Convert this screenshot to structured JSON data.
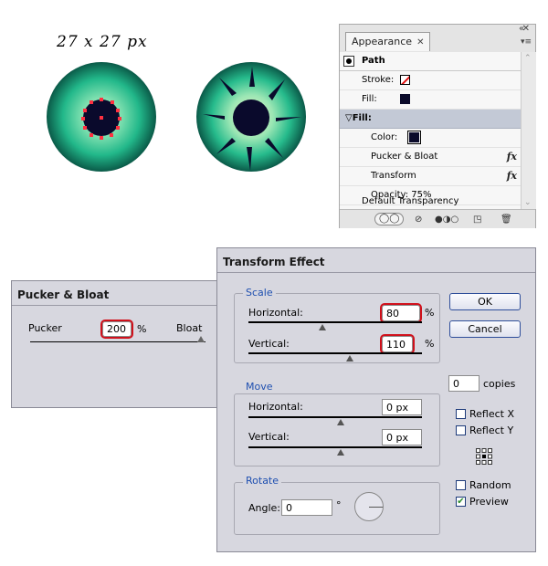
{
  "size_label": "27 x 27 px",
  "appearance": {
    "tab": "Appearance",
    "path_label": "Path",
    "stroke_label": "Stroke:",
    "fill_label": "Fill:",
    "fill_group": "Fill:",
    "color_label": "Color:",
    "pucker_bloat": "Pucker & Bloat",
    "transform": "Transform",
    "opacity": "Opacity: 75%",
    "default_transparency": "Default Transparency",
    "fx_label": "fx",
    "close_glyph": "✕",
    "collapse_glyph": "«",
    "tab_close": "✕",
    "menu_glyph": "▾≡",
    "fill_color": "#0a0a2a"
  },
  "pucker_dialog": {
    "title": "Pucker & Bloat",
    "left_label": "Pucker",
    "value": "200",
    "unit": "%",
    "right_label": "Bloat"
  },
  "transform_dialog": {
    "title": "Transform Effect",
    "scale": {
      "label": "Scale",
      "horizontal_label": "Horizontal:",
      "horizontal_value": "80",
      "vertical_label": "Vertical:",
      "vertical_value": "110",
      "unit": "%"
    },
    "move": {
      "label": "Move",
      "horizontal_label": "Horizontal:",
      "horizontal_value": "0 px",
      "vertical_label": "Vertical:",
      "vertical_value": "0 px"
    },
    "rotate": {
      "label": "Rotate",
      "angle_label": "Angle:",
      "angle_value": "0",
      "degree": "°"
    },
    "ok": "OK",
    "cancel": "Cancel",
    "copies_value": "0",
    "copies_label": "copies",
    "reflect_x": "Reflect X",
    "reflect_y": "Reflect Y",
    "random": "Random",
    "preview": "Preview",
    "preview_checked": true
  }
}
